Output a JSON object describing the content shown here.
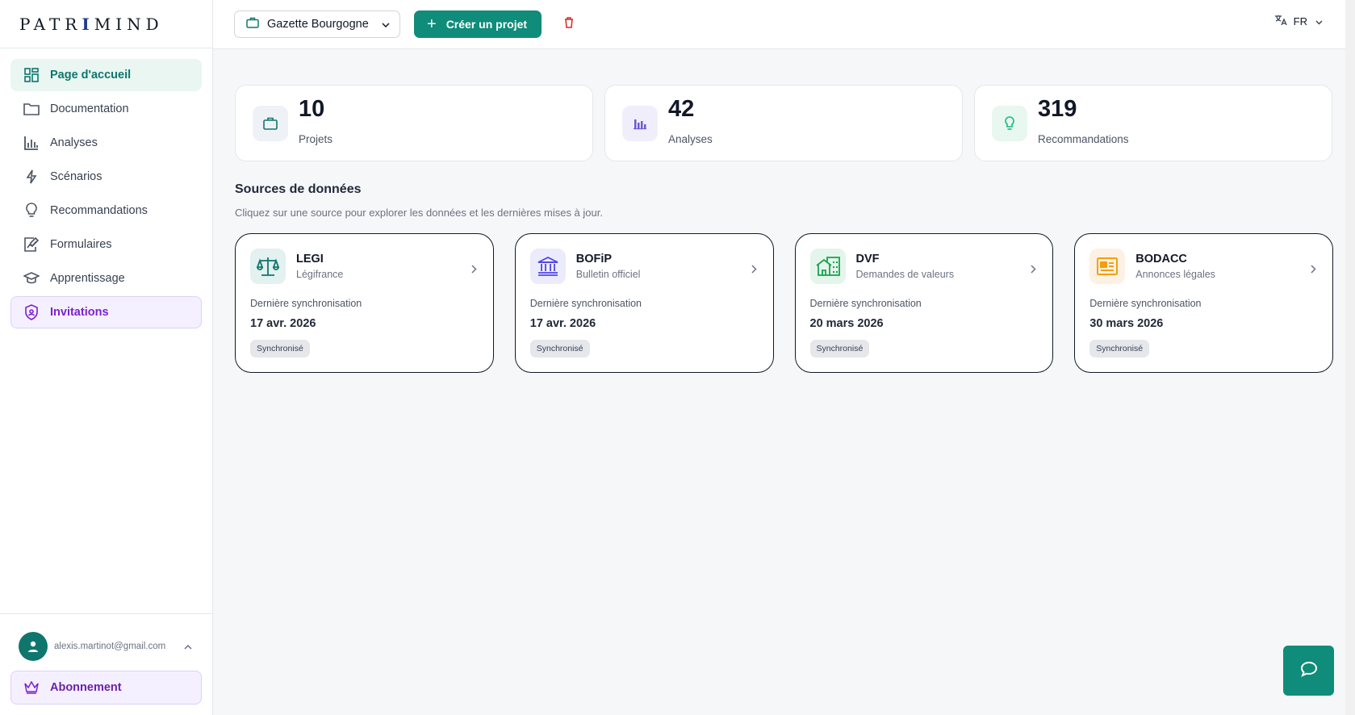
{
  "brand": {
    "name_before": "PATR",
    "name_mark": "I",
    "name_after": "MIND"
  },
  "sidebar": {
    "items": [
      {
        "label": "Page d'accueil"
      },
      {
        "label": "Documentation"
      },
      {
        "label": "Analyses"
      },
      {
        "label": "Scénarios"
      },
      {
        "label": "Recommandations"
      },
      {
        "label": "Formulaires"
      },
      {
        "label": "Apprentissage"
      },
      {
        "label": "Invitations"
      }
    ],
    "user_email": "alexis.martinot@gmail.com",
    "subscription_label": "Abonnement"
  },
  "topbar": {
    "project_name": "Gazette Bourgogne",
    "create_label": "Créer un projet",
    "language": "FR"
  },
  "stats": [
    {
      "value": "10",
      "label": "Projets"
    },
    {
      "value": "42",
      "label": "Analyses"
    },
    {
      "value": "319",
      "label": "Recommandations"
    }
  ],
  "sources_section": {
    "title": "Sources de données",
    "subtitle": "Cliquez sur une source pour explorer les données et les dernières mises à jour."
  },
  "sources": [
    {
      "name": "LEGI",
      "desc": "Légifrance",
      "sync_label": "Dernière synchronisation",
      "date": "17 avr. 2026",
      "status": "Synchronisé"
    },
    {
      "name": "BOFiP",
      "desc": "Bulletin officiel",
      "sync_label": "Dernière synchronisation",
      "date": "17 avr. 2026",
      "status": "Synchronisé"
    },
    {
      "name": "DVF",
      "desc": "Demandes de valeurs",
      "sync_label": "Dernière synchronisation",
      "date": "20 mars 2026",
      "status": "Synchronisé"
    },
    {
      "name": "BODACC",
      "desc": "Annonces légales",
      "sync_label": "Dernière synchronisation",
      "date": "30 mars 2026",
      "status": "Synchronisé"
    }
  ],
  "colors": {
    "primary": "#0f8c7a",
    "accent_purple": "#7e22ce",
    "danger": "#dc2626"
  }
}
